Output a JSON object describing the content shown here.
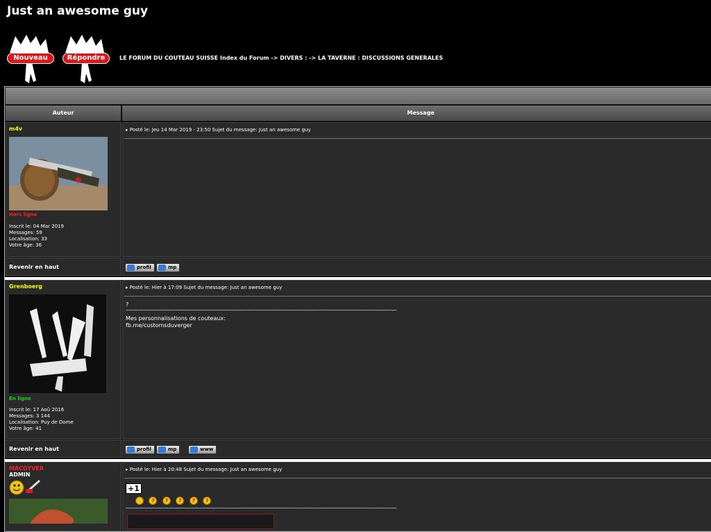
{
  "topic_title": "Just an awesome guy",
  "buttons": {
    "new": "Nouveau",
    "reply": "Répondre"
  },
  "breadcrumb": "LE FORUM DU COUTEAU SUISSE Index du Forum -> DIVERS : -> LA TAVERNE : DISCUSSIONS GENERALES",
  "columns": {
    "author": "Auteur",
    "message": "Message"
  },
  "back_to_top": "Revenir en haut",
  "tilde_line": "~~~~~~~~~~~~~~~~~~~~~~~~~~~~~~~~~~~~~~~~~~~~~~~~~~~~~~~~~~~~~~~~~~~~~~~~~~~~~~~~~~~~~~~~~~~~~~~~~~~~~~~~~",
  "posts": [
    {
      "author": "m4v",
      "author_color": "#ffff00",
      "status": "Hors ligne",
      "status_color": "#ff2020",
      "info": [
        "Inscrit le: 04 Mar 2019",
        "Messages: 59",
        "Localisation: 33",
        "Votre âge: 36"
      ],
      "posted": "Posté le: Jeu 14 Mar 2019 - 23:50    Sujet du message: Just an awesome guy",
      "buttons": [
        "profil",
        "mp"
      ]
    },
    {
      "author": "Grenboerg",
      "author_color": "#ffff00",
      "status": "En ligne",
      "status_color": "#20d020",
      "info": [
        "Inscrit le: 17 Aoû 2016",
        "Messages: 3 144",
        "Localisation: Puy de Dome",
        "Votre âge: 41"
      ],
      "posted": "Posté le: Hier à 17:09    Sujet du message: Just an awesome guy",
      "body": [
        "?"
      ],
      "signature": [
        "Mes personnalisations de couteaux:",
        "fb.me/customsduverger"
      ],
      "buttons": [
        "profil",
        "mp",
        "www"
      ]
    },
    {
      "author": "MACGYVER",
      "author_color": "#ff2020",
      "rank": "ADMIN",
      "posted": "Posté le: Hier à 20:48    Sujet du message: Just an awesome guy",
      "plus_one": "+1"
    }
  ]
}
